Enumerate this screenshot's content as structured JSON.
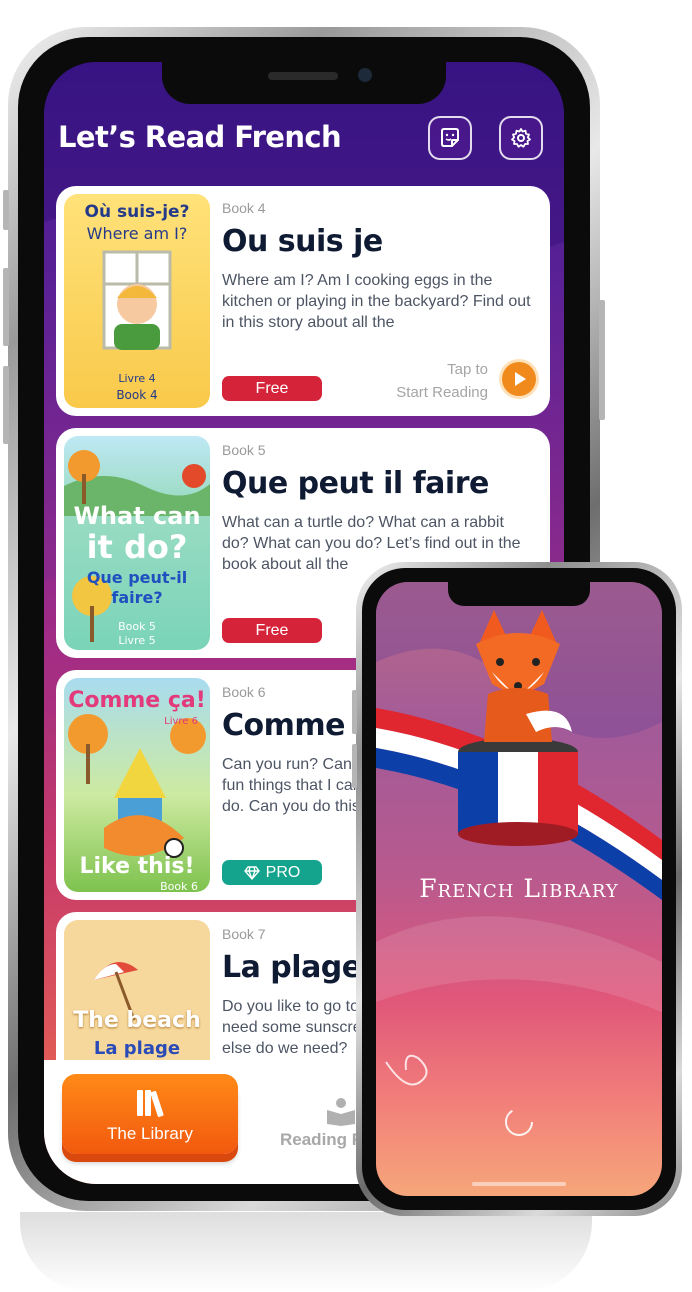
{
  "app": {
    "title": "Let’s Read French"
  },
  "header": {
    "sticker_icon": "sticker-icon",
    "settings_icon": "gear-icon"
  },
  "books": [
    {
      "number": "Book 4",
      "title": "Ou suis je",
      "description": "Where am I? Am I cooking eggs in the kitchen or playing in the backyard? Find out in this story about all the",
      "badge": "Free",
      "badge_type": "free",
      "cover": {
        "line1": "Où suis-je?",
        "line2": "Where am I?",
        "line3": "Livre 4",
        "line4": "Book 4"
      },
      "tap_line1": "Tap to",
      "tap_line2": "Start Reading"
    },
    {
      "number": "Book 5",
      "title": "Que peut il faire",
      "description": "What can a turtle do? What can a rabbit do? What can you do? Let’s find out in the book about all the",
      "badge": "Free",
      "badge_type": "free",
      "cover": {
        "line1": "What can",
        "line2": "it do?",
        "line3": "Que peut-il",
        "line4": "faire?",
        "line5": "Book 5",
        "line6": "Livre 5"
      }
    },
    {
      "number": "Book 6",
      "title": "Comme ça",
      "description": "Can you run? Can you jump? Look at the fun things that I can do and see if you can do. Can you do this?",
      "badge": "PRO",
      "badge_type": "pro",
      "cover": {
        "line1": "Comme ça!",
        "line2": "Livre 6",
        "line3": "Like this!",
        "line4": "Book 6"
      }
    },
    {
      "number": "Book 7",
      "title": "La plage",
      "description": "Do you like to go to the beach? Do you need some sunscreen and a hat? What else do we need?",
      "cover": {
        "line1": "The beach",
        "line2": "La plage"
      }
    }
  ],
  "tabbar": {
    "library_label": "The Library",
    "reading_label": "Reading R"
  },
  "splash": {
    "title": "French Library",
    "flag_colors": [
      "#0d3fa8",
      "#ffffff",
      "#e0262e"
    ],
    "mascot": "fox-mascot"
  },
  "colors": {
    "accent_orange": "#f2690f",
    "free_red": "#d5243a",
    "pro_teal": "#14a38c",
    "header_purple": "#3f1a8f"
  }
}
